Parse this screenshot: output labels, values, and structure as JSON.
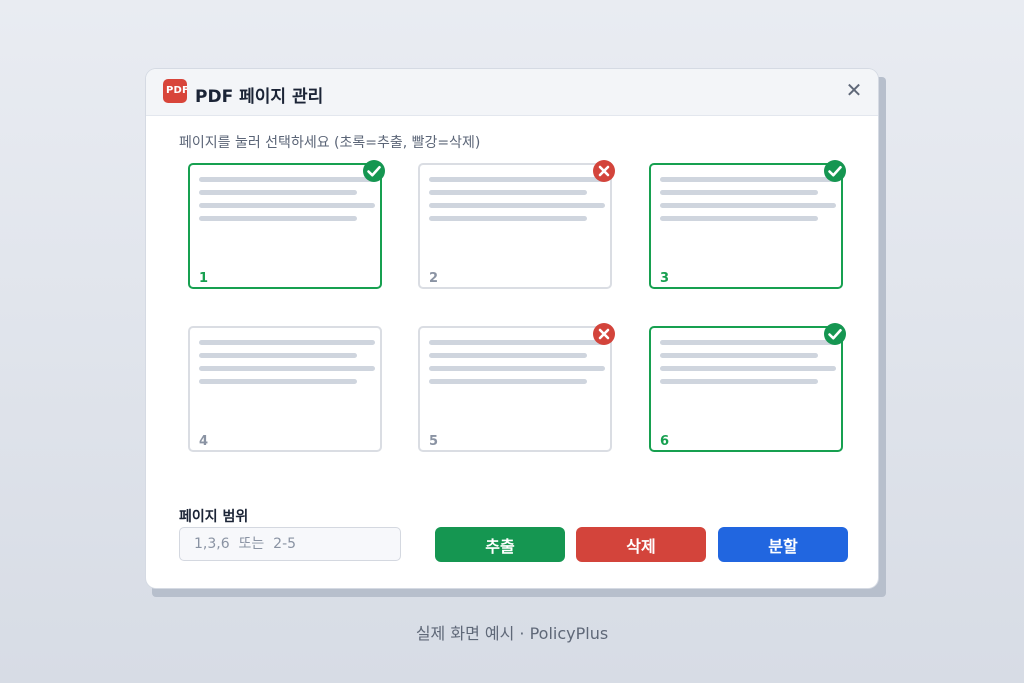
{
  "dialog": {
    "logo_text": "PDF",
    "title": "PDF 페이지 관리",
    "close_icon": "close-icon",
    "instruction": "페이지를 눌러 선택하세요 (초록=추출, 빨강=삭제)"
  },
  "pages": [
    {
      "number": "1",
      "state": "extract",
      "icon": "check-circle-icon"
    },
    {
      "number": "2",
      "state": "delete",
      "icon": "x-circle-icon"
    },
    {
      "number": "3",
      "state": "extract",
      "icon": "check-circle-icon"
    },
    {
      "number": "4",
      "state": "none",
      "icon": ""
    },
    {
      "number": "5",
      "state": "delete",
      "icon": "x-circle-icon"
    },
    {
      "number": "6",
      "state": "extract",
      "icon": "check-circle-icon"
    }
  ],
  "range": {
    "label": "페이지 범위",
    "placeholder": "1,3,6  또는  2-5",
    "value": ""
  },
  "buttons": {
    "extract": "추출",
    "delete": "삭제",
    "split": "분할"
  },
  "colors": {
    "extract": "#159651",
    "delete": "#d3443b",
    "split": "#2166e0"
  },
  "caption": "실제 화면 예시 · PolicyPlus"
}
